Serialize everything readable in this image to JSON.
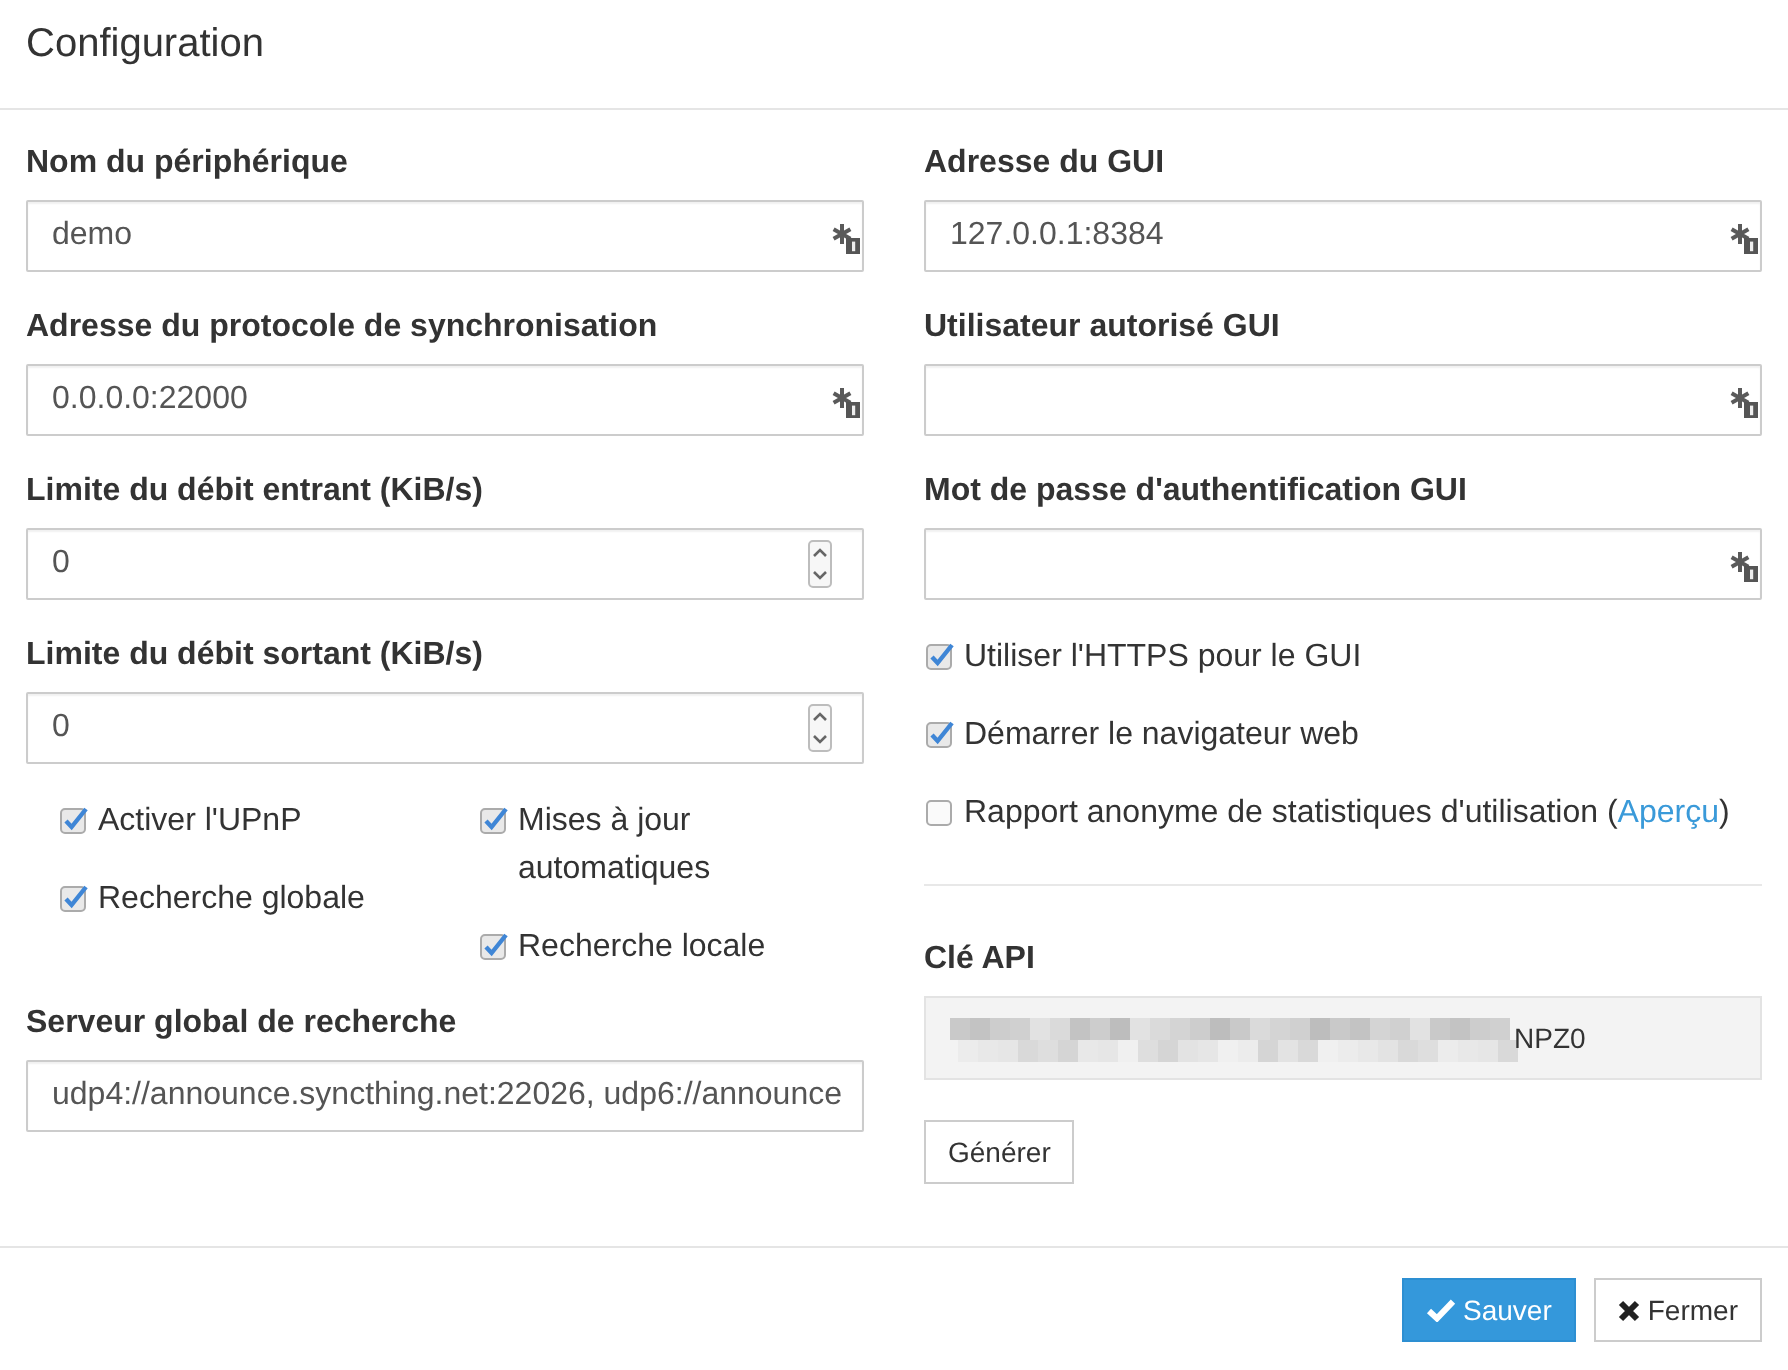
{
  "dialog": {
    "title": "Configuration"
  },
  "left_fields": [
    {
      "kind": "text",
      "label": "Nom du périphérique",
      "value": "demo",
      "autofill": true
    },
    {
      "kind": "text",
      "label": "Adresse du protocole de synchronisation",
      "value": "0.0.0.0:22000",
      "autofill": true
    },
    {
      "kind": "number",
      "label": "Limite du débit entrant (KiB/s)",
      "value": "0",
      "autofill": false
    },
    {
      "kind": "number",
      "label": "Limite du débit sortant (KiB/s)",
      "value": "0",
      "autofill": false
    }
  ],
  "option_columns": [
    {
      "items": [
        {
          "label": "Activer l'UPnP",
          "checked": true
        },
        {
          "label": "Recherche globale",
          "checked": true
        }
      ]
    },
    {
      "items": [
        {
          "label": "Mises à jour automatiques",
          "checked": true
        },
        {
          "label": "Recherche locale",
          "checked": true
        }
      ]
    }
  ],
  "discovery_server": {
    "kind": "text",
    "label": "Serveur global de recherche",
    "value": "udp4://announce.syncthing.net:22026, udp6://announce"
  },
  "right_fields": [
    {
      "kind": "text",
      "label": "Adresse du GUI",
      "value": "127.0.0.1:8384",
      "autofill": true
    },
    {
      "kind": "text",
      "label": "Utilisateur autorisé GUI",
      "autofill": true
    },
    {
      "kind": "text",
      "label": "Mot de passe d'authentification GUI",
      "autofill": true
    }
  ],
  "gui_options": [
    {
      "label": "Utiliser l'HTTPS pour le GUI",
      "checked": true
    },
    {
      "label": "Démarrer le navigateur web",
      "checked": true
    },
    {
      "label": "Rapport anonyme de statistiques d'utilisation (",
      "checked": false,
      "link": "Aperçu",
      "label_end": ")"
    }
  ],
  "api_key": {
    "label": "Clé API",
    "redacted": true,
    "value": "NPZ0",
    "button": "Générer"
  },
  "footer_buttons": [
    {
      "kind": "primary",
      "label": "Sauver"
    },
    {
      "kind": "default",
      "label": "Fermer"
    }
  ]
}
